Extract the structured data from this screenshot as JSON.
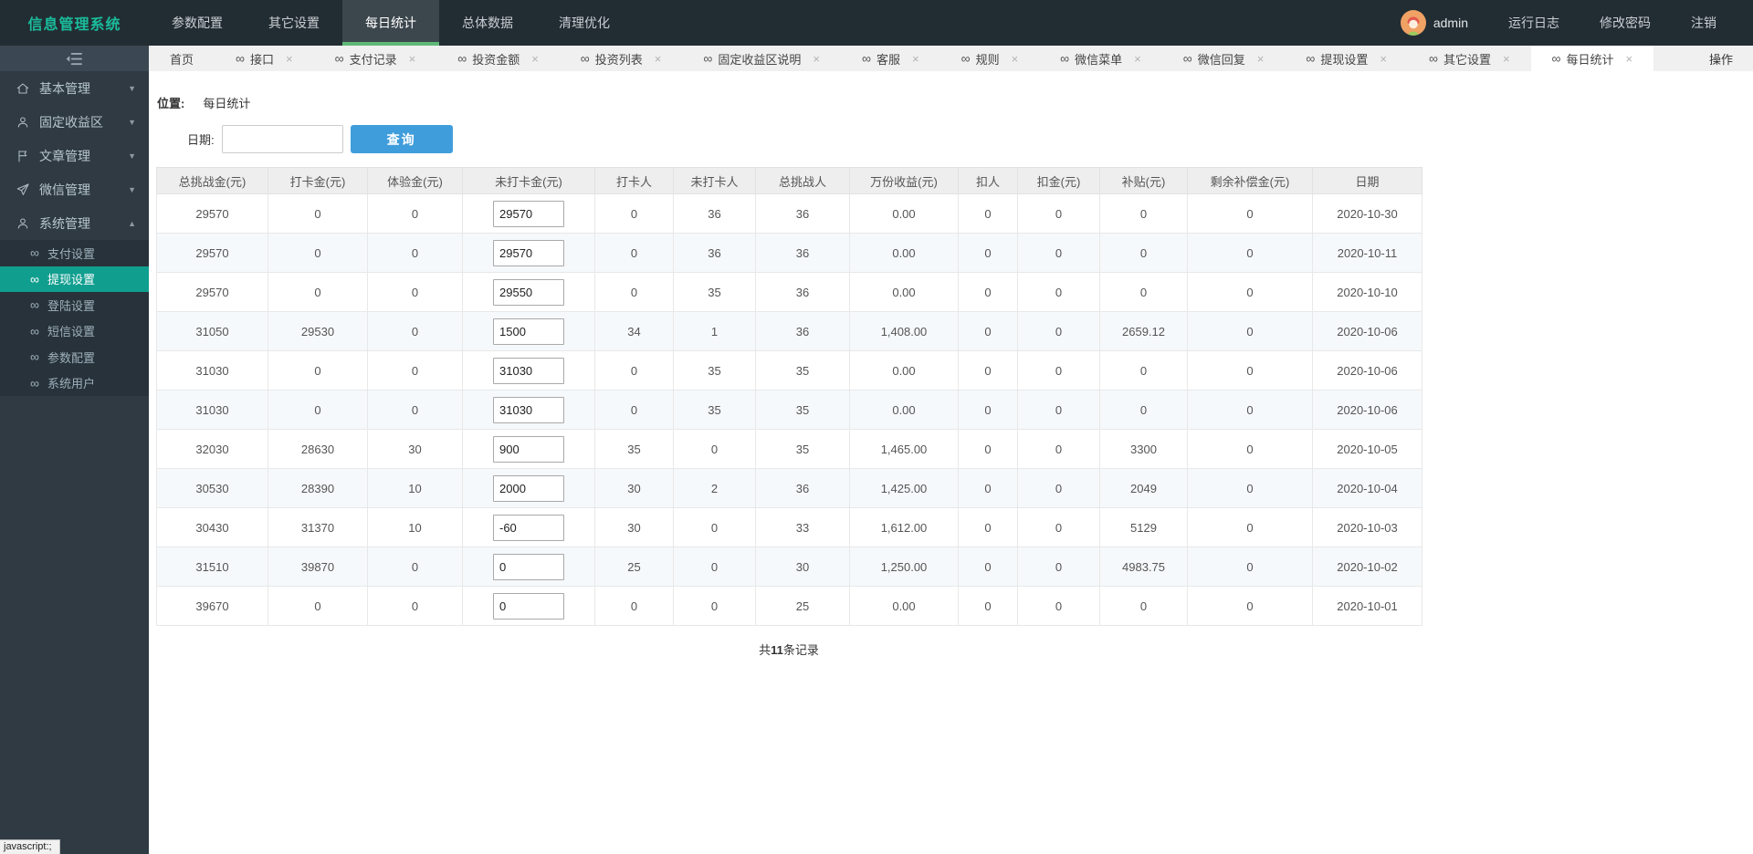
{
  "browser_status": "javascript:;",
  "colors": {
    "brand_green": "#1abc9c",
    "navbar_active_underline": "#5fb878",
    "sidebar_active_teal": "#109e8f",
    "query_button_blue": "#409ddb"
  },
  "navbar": {
    "brand": "信息管理系统",
    "items": [
      {
        "label": "参数配置",
        "active": false
      },
      {
        "label": "其它设置",
        "active": false
      },
      {
        "label": "每日统计",
        "active": true
      },
      {
        "label": "总体数据",
        "active": false
      },
      {
        "label": "清理优化",
        "active": false
      }
    ],
    "user": {
      "name": "admin",
      "avatar_icon": "user-avatar"
    },
    "actions": [
      {
        "label": "运行日志"
      },
      {
        "label": "修改密码"
      },
      {
        "label": "注销"
      }
    ]
  },
  "sidebar": {
    "toggle_icon": "sidebar-collapse-icon",
    "child_icon": "infinity-icon",
    "groups": [
      {
        "label": "基本管理",
        "icon": "home-icon",
        "state": "collapsed"
      },
      {
        "label": "固定收益区",
        "icon": "user-icon",
        "state": "collapsed"
      },
      {
        "label": "文章管理",
        "icon": "flag-icon",
        "state": "collapsed"
      },
      {
        "label": "微信管理",
        "icon": "send-icon",
        "state": "collapsed"
      },
      {
        "label": "系统管理",
        "icon": "person-icon",
        "state": "expanded",
        "children": [
          {
            "label": "支付设置",
            "active": false
          },
          {
            "label": "提现设置",
            "active": true
          },
          {
            "label": "登陆设置",
            "active": false
          },
          {
            "label": "短信设置",
            "active": false
          },
          {
            "label": "参数配置",
            "active": false
          },
          {
            "label": "系统用户",
            "active": false
          }
        ]
      }
    ]
  },
  "tabs": {
    "icon": "infinity-icon",
    "close_icon": "close-icon",
    "more_label": "操作",
    "items": [
      {
        "label": "首页",
        "icon": false,
        "closable": false,
        "active": false
      },
      {
        "label": "接口",
        "icon": true,
        "closable": true,
        "active": false
      },
      {
        "label": "支付记录",
        "icon": true,
        "closable": true,
        "active": false
      },
      {
        "label": "投资金额",
        "icon": true,
        "closable": true,
        "active": false
      },
      {
        "label": "投资列表",
        "icon": true,
        "closable": true,
        "active": false
      },
      {
        "label": "固定收益区说明",
        "icon": true,
        "closable": true,
        "active": false
      },
      {
        "label": "客服",
        "icon": true,
        "closable": true,
        "active": false
      },
      {
        "label": "规则",
        "icon": true,
        "closable": true,
        "active": false
      },
      {
        "label": "微信菜单",
        "icon": true,
        "closable": true,
        "active": false
      },
      {
        "label": "微信回复",
        "icon": true,
        "closable": true,
        "active": false
      },
      {
        "label": "提现设置",
        "icon": true,
        "closable": true,
        "active": false
      },
      {
        "label": "其它设置",
        "icon": true,
        "closable": true,
        "active": false
      },
      {
        "label": "每日统计",
        "icon": true,
        "closable": true,
        "active": true
      }
    ]
  },
  "breadcrumb": {
    "label": "位置:",
    "current": "每日统计"
  },
  "search": {
    "date_label": "日期:",
    "date_value": "",
    "button_label": "查询"
  },
  "table": {
    "columns": [
      "总挑战金(元)",
      "打卡金(元)",
      "体验金(元)",
      "未打卡金(元)",
      "打卡人",
      "未打卡人",
      "总挑战人",
      "万份收益(元)",
      "扣人",
      "扣金(元)",
      "补贴(元)",
      "剩余补偿金(元)",
      "日期"
    ],
    "input_column_index": 3,
    "rows": [
      [
        "29570",
        "0",
        "0",
        "29570",
        "0",
        "36",
        "36",
        "0.00",
        "0",
        "0",
        "0",
        "0",
        "2020-10-30"
      ],
      [
        "29570",
        "0",
        "0",
        "29570",
        "0",
        "36",
        "36",
        "0.00",
        "0",
        "0",
        "0",
        "0",
        "2020-10-11"
      ],
      [
        "29570",
        "0",
        "0",
        "29550",
        "0",
        "35",
        "36",
        "0.00",
        "0",
        "0",
        "0",
        "0",
        "2020-10-10"
      ],
      [
        "31050",
        "29530",
        "0",
        "1500",
        "34",
        "1",
        "36",
        "1,408.00",
        "0",
        "0",
        "2659.12",
        "0",
        "2020-10-06"
      ],
      [
        "31030",
        "0",
        "0",
        "31030",
        "0",
        "35",
        "35",
        "0.00",
        "0",
        "0",
        "0",
        "0",
        "2020-10-06"
      ],
      [
        "31030",
        "0",
        "0",
        "31030",
        "0",
        "35",
        "35",
        "0.00",
        "0",
        "0",
        "0",
        "0",
        "2020-10-06"
      ],
      [
        "32030",
        "28630",
        "30",
        "900",
        "35",
        "0",
        "35",
        "1,465.00",
        "0",
        "0",
        "3300",
        "0",
        "2020-10-05"
      ],
      [
        "30530",
        "28390",
        "10",
        "2000",
        "30",
        "2",
        "36",
        "1,425.00",
        "0",
        "0",
        "2049",
        "0",
        "2020-10-04"
      ],
      [
        "30430",
        "31370",
        "10",
        "-60",
        "30",
        "0",
        "33",
        "1,612.00",
        "0",
        "0",
        "5129",
        "0",
        "2020-10-03"
      ],
      [
        "31510",
        "39870",
        "0",
        "0",
        "25",
        "0",
        "30",
        "1,250.00",
        "0",
        "0",
        "4983.75",
        "0",
        "2020-10-02"
      ],
      [
        "39670",
        "0",
        "0",
        "0",
        "0",
        "0",
        "25",
        "0.00",
        "0",
        "0",
        "0",
        "0",
        "2020-10-01"
      ]
    ],
    "footer": {
      "prefix": "共",
      "count": "11",
      "suffix": "条记录"
    }
  }
}
